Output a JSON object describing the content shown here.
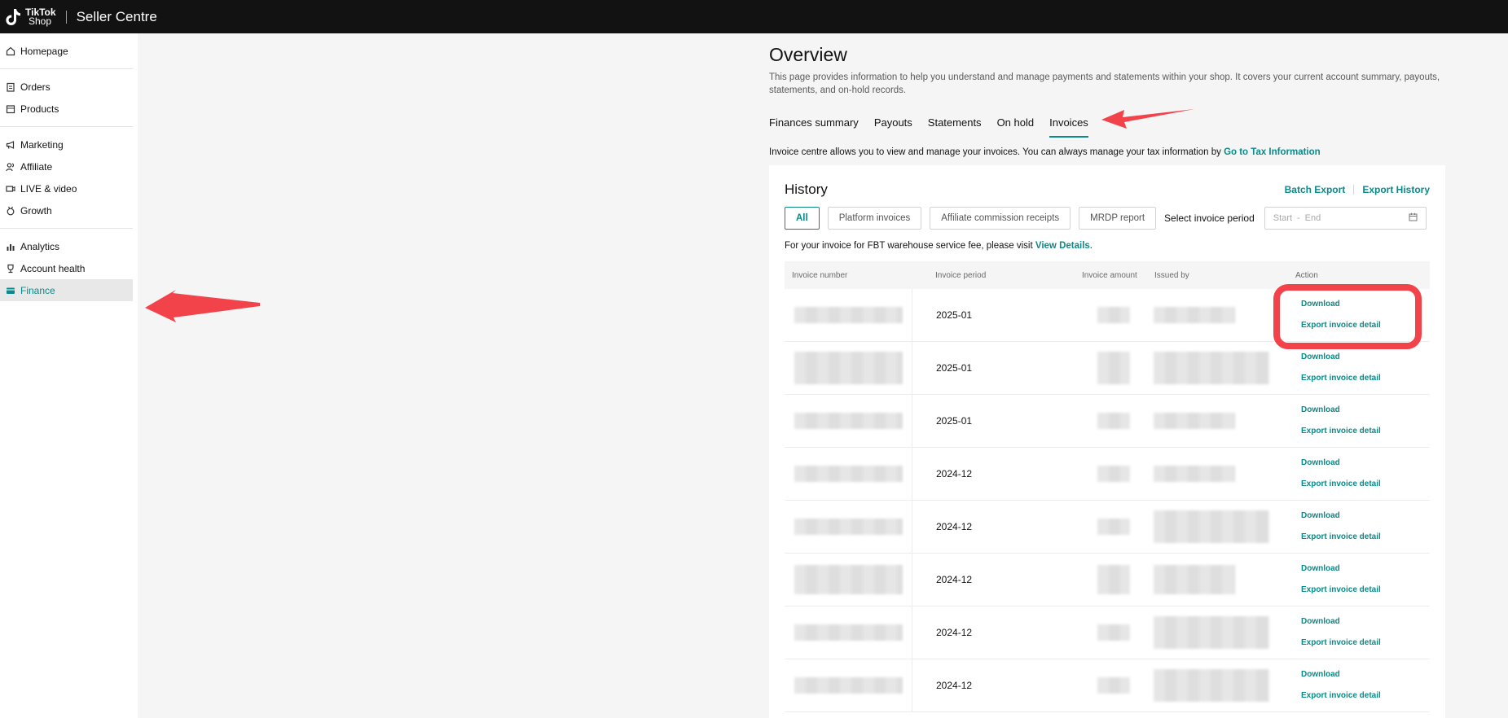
{
  "header": {
    "logo_line1": "TikTok",
    "logo_line2": "Shop",
    "app_title": "Seller Centre"
  },
  "sidebar": {
    "groups": [
      {
        "items": [
          {
            "label": "Homepage",
            "icon": "home-icon"
          }
        ]
      },
      {
        "items": [
          {
            "label": "Orders",
            "icon": "clipboard-icon"
          },
          {
            "label": "Products",
            "icon": "box-icon"
          }
        ]
      },
      {
        "items": [
          {
            "label": "Marketing",
            "icon": "megaphone-icon"
          },
          {
            "label": "Affiliate",
            "icon": "users-icon"
          },
          {
            "label": "LIVE & video",
            "icon": "video-icon"
          },
          {
            "label": "Growth",
            "icon": "medal-icon"
          }
        ]
      },
      {
        "items": [
          {
            "label": "Analytics",
            "icon": "bar-chart-icon"
          },
          {
            "label": "Account health",
            "icon": "trophy-icon"
          },
          {
            "label": "Finance",
            "icon": "card-icon",
            "active": true
          }
        ]
      }
    ]
  },
  "main": {
    "title": "Overview",
    "description": "This page provides information to help you understand and manage payments and statements within your shop. It covers your current account summary, payouts, statements, and on-hold records.",
    "tabs": [
      {
        "label": "Finances summary"
      },
      {
        "label": "Payouts"
      },
      {
        "label": "Statements"
      },
      {
        "label": "On hold"
      },
      {
        "label": "Invoices",
        "active": true
      }
    ],
    "info_text": "Invoice centre allows you to view and manage your invoices. You can always manage your tax information by ",
    "info_link": "Go to Tax Information"
  },
  "history": {
    "title": "History",
    "batch_export": "Batch Export",
    "export_history": "Export History",
    "filters": [
      "All",
      "Platform invoices",
      "Affiliate commission receipts",
      "MRDP report"
    ],
    "period_label": "Select invoice period",
    "date_start": "Start",
    "date_dash": "-",
    "date_end": "End",
    "fbt_text": "For your invoice for FBT warehouse service fee, please visit ",
    "fbt_link": "View Details",
    "fbt_end": ".",
    "columns": [
      "Invoice number",
      "Invoice period",
      "Invoice amount",
      "Issued by",
      "Action"
    ],
    "rows": [
      {
        "period": "2025-01"
      },
      {
        "period": "2025-01"
      },
      {
        "period": "2025-01"
      },
      {
        "period": "2024-12"
      },
      {
        "period": "2024-12"
      },
      {
        "period": "2024-12"
      },
      {
        "period": "2024-12"
      },
      {
        "period": "2024-12"
      }
    ],
    "action_download": "Download",
    "action_export": "Export invoice detail"
  },
  "colors": {
    "accent": "#0a8a8a",
    "topbar": "#121212",
    "annotation": "#f2434b"
  }
}
